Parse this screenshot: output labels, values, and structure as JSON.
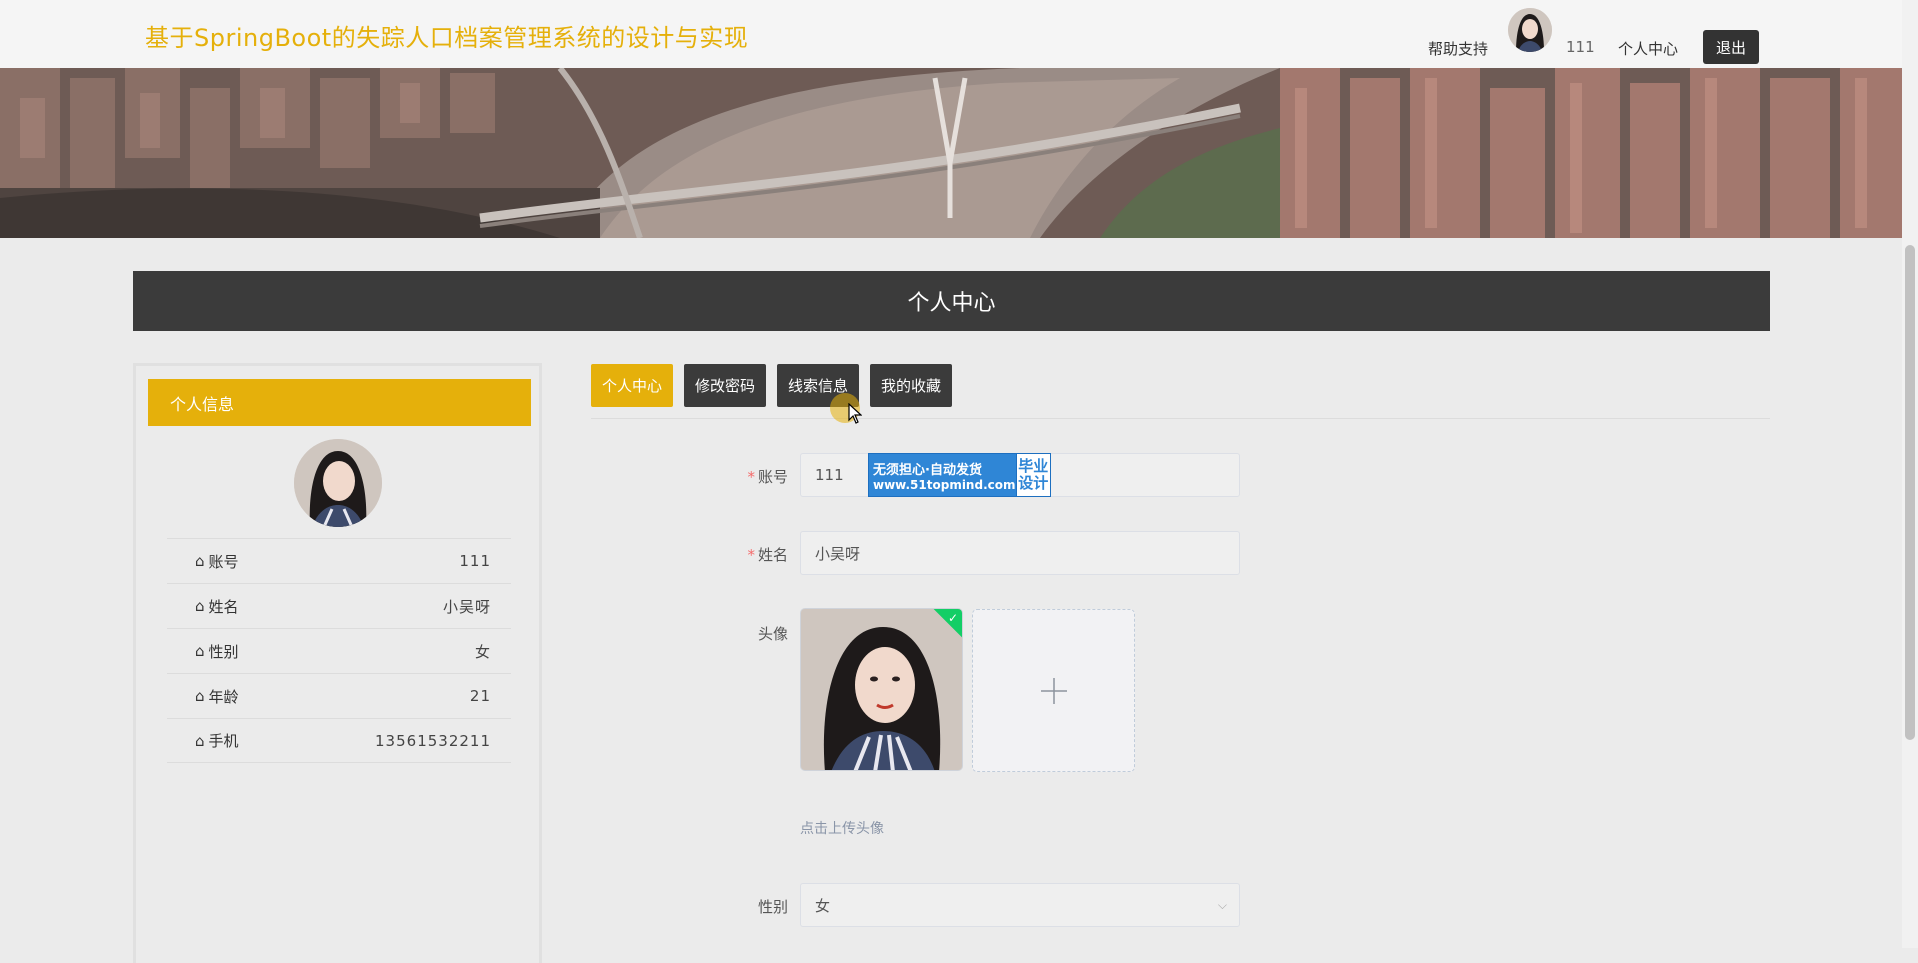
{
  "header": {
    "title": "基于SpringBoot的失踪人口档案管理系统的设计与实现",
    "help": "帮助支持",
    "username": "111",
    "center": "个人中心",
    "logout": "退出"
  },
  "banner": {
    "slides": 3,
    "active_index": 0
  },
  "section": {
    "title": "个人中心"
  },
  "profile_card": {
    "heading": "个人信息",
    "rows": [
      {
        "label": "账号",
        "value": "111"
      },
      {
        "label": "姓名",
        "value": "小吴呀"
      },
      {
        "label": "性别",
        "value": "女"
      },
      {
        "label": "年龄",
        "value": "21"
      },
      {
        "label": "手机",
        "value": "13561532211"
      }
    ]
  },
  "tabs": [
    {
      "label": "个人中心",
      "active": true
    },
    {
      "label": "修改密码",
      "active": false
    },
    {
      "label": "线索信息",
      "active": false
    },
    {
      "label": "我的收藏",
      "active": false
    }
  ],
  "form": {
    "account_label": "账号",
    "account_value": "111",
    "name_label": "姓名",
    "name_value": "小吴呀",
    "avatar_label": "头像",
    "upload_tip": "点击上传头像",
    "gender_label": "性别",
    "gender_value": "女"
  },
  "watermark": {
    "line1": "无须担心·自动发货",
    "line2": "www.51topmind.com",
    "badge_line1": "毕业",
    "badge_line2": "设计"
  },
  "colors": {
    "accent": "#e5b00b",
    "dark": "#3b3b3b",
    "required": "#f56c6c",
    "success": "#13ce66"
  }
}
